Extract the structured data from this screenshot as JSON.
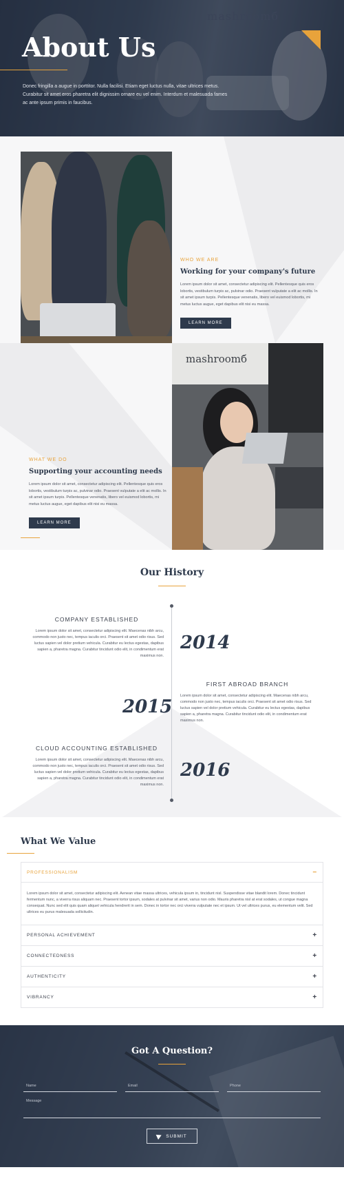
{
  "hero": {
    "brand": "mashroomб",
    "title": "About Us",
    "text": "Donec fringilla a augue in porttitor. Nulla facilisi. Etiam eget luctus nulla, vitae ultrices metus. Curabitur sit amet eros pharetra elit dignissim ornare eu vel enim. Interdum et malesuada fames ac ante ipsum primis in faucibus."
  },
  "who": {
    "eyebrow": "WHO WE ARE",
    "heading": "Working for your company's future",
    "text": "Lorem ipsum dolor sit amet, consectetur adipiscing elit. Pellentesque quis eros lobortis, vestibulum turpis ac, pulvinar odio. Praesent vulputate a elit ac mollis. In sit amet ipsum turpis. Pellentesque venenatis, libero vel euismod lobortis, mi metus luctus augue, eget dapibus elit nisi eu massa.",
    "button": "LEARN MORE"
  },
  "what": {
    "brand": "mashroomб",
    "eyebrow": "WHAT WE DO",
    "heading": "Supporting your accounting needs",
    "text": "Lorem ipsum dolor sit amet, consectetur adipiscing elit. Pellentesque quis eros lobortis, vestibulum turpis ac, pulvinar odio. Praesent vulputate a elit ac mollis. In sit amet ipsum turpis. Pellentesque venenatis, libero vel euismod lobortis, mi metus luctus augue, eget dapibus elit nisi eu massa.",
    "button": "LEARN MORE"
  },
  "history": {
    "title": "Our History",
    "events": [
      {
        "title": "COMPANY ESTABLISHED",
        "year": "2014",
        "text": "Lorem ipsum dolor sit amet, consectetur adipiscing elit. Maecenas nibh arcu, commodo non justo nec, tempus iaculis orci. Praesent sit amet odio risus. Sed luctus sapien vel dolor pretium vehicula. Curabitur eu lectus egestas, dapibus sapien a, pharetra magna. Curabitur tincidunt odio elit, in condimentum erat maximus non."
      },
      {
        "title": "FIRST ABROAD BRANCH",
        "year": "2015",
        "text": "Lorem ipsum dolor sit amet, consectetur adipiscing elit. Maecenas nibh arcu, commodo non justo nec, tempus iaculis orci. Praesent sit amet odio risus. Sed luctus sapien vel dolor pretium vehicula. Curabitur eu lectus egestas, dapibus sapien a, pharetra magna. Curabitur tincidunt odio elit, in condimentum erat maximus non."
      },
      {
        "title": "CLOUD ACCOUNTING ESTABLISHED",
        "year": "2016",
        "text": "Lorem ipsum dolor sit amet, consectetur adipiscing elit. Maecenas nibh arcu, commodo non justo nec, tempus iaculis orci. Praesent sit amet odio risus. Sed luctus sapien vel dolor pretium vehicula. Curabitur eu lectus egestas, dapibus sapien a, pharetra magna. Curabitur tincidunt odio elit, in condimentum erat maximus non."
      }
    ]
  },
  "values": {
    "title": "What We Value",
    "items": [
      {
        "label": "PROFESSIONALISM",
        "sign": "−",
        "body": "Lorem ipsum dolor sit amet, consectetur adipiscing elit. Aenean vitae massa ultrices, vehicula ipsum in, tincidunt nisl. Suspendisse vitae blandit lorem. Donec tincidunt fermentum nunc, a viverra risus aliquam nec. Praesent tortor ipsum, sodales at pulvinar sit amet, varius non odio. Mauris pharetra nisl at erat sodales, ut congue magna consequat. Nunc sed elit quis quam aliquet vehicula hendrerit in sem. Donec in tortor nec orci viverra vulputate nec et ipsum. Ut vel ultrices purus, eu elementum velit. Sed ultrices eu purus malesuada sollicitudin."
      },
      {
        "label": "PERSONAL ACHIEVEMENT",
        "sign": "+"
      },
      {
        "label": "CONNECTEDNESS",
        "sign": "+"
      },
      {
        "label": "AUTHENTICITY",
        "sign": "+"
      },
      {
        "label": "VIBRANCY",
        "sign": "+"
      }
    ]
  },
  "contact": {
    "title": "Got A Question?",
    "name_placeholder": "Name",
    "email_placeholder": "Email",
    "phone_placeholder": "Phone",
    "message_placeholder": "Message",
    "submit": "SUBMIT"
  },
  "colors": {
    "accent": "#e8a33b",
    "navy": "#2e3a4c"
  }
}
